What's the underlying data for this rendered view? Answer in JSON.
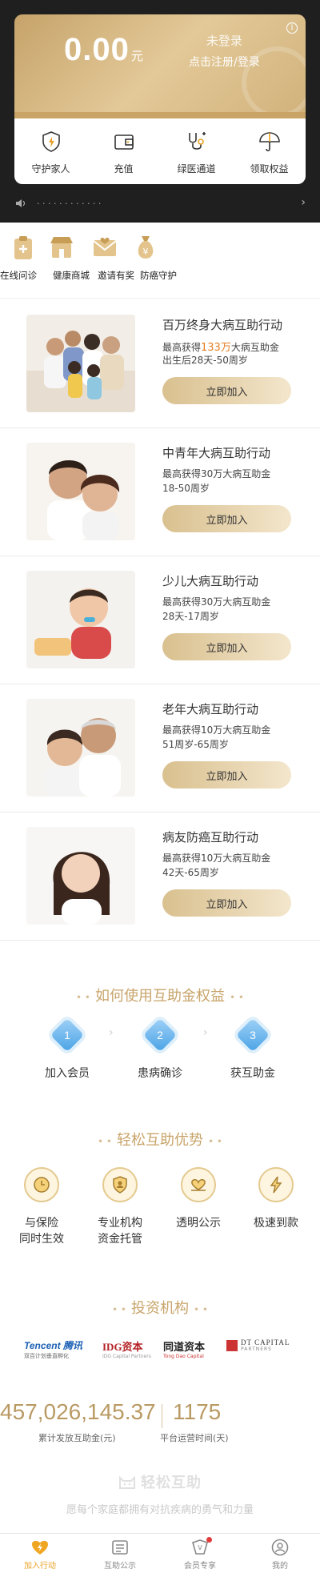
{
  "account": {
    "amount_int": "0",
    "amount_dec": ".00",
    "unit": "元",
    "login_status": "未登录",
    "login_prompt": "点击注册/登录"
  },
  "actions": [
    {
      "label": "守护家人",
      "icon": "shield-lightning-icon"
    },
    {
      "label": "充值",
      "icon": "wallet-icon"
    },
    {
      "label": "绿医通道",
      "icon": "stethoscope-icon"
    },
    {
      "label": "领取权益",
      "icon": "umbrella-icon"
    }
  ],
  "notice": {
    "icon": "speaker-icon",
    "text": "· ·  · · · · · · ·  · · ·"
  },
  "quick_nav": [
    {
      "label": "在线问诊",
      "icon": "clipboard-plus-icon"
    },
    {
      "label": "健康商城",
      "icon": "store-icon"
    },
    {
      "label": "邀请有奖",
      "icon": "envelope-heart-icon"
    },
    {
      "label": "防癌守护",
      "icon": "money-bag-icon"
    }
  ],
  "products": [
    {
      "title": "百万终身大病互助行动",
      "prefix": "最高获得",
      "highlight": "133万",
      "suffix": "大病互助金",
      "age": "出生后28天-50周岁",
      "button": "立即加入"
    },
    {
      "title": "中青年大病互助行动",
      "prefix": "最高获得30万大病互助金",
      "highlight": "",
      "suffix": "",
      "age": "18-50周岁",
      "button": "立即加入"
    },
    {
      "title": "少儿大病互助行动",
      "prefix": "最高获得30万大病互助金",
      "highlight": "",
      "suffix": "",
      "age": "28天-17周岁",
      "button": "立即加入"
    },
    {
      "title": "老年大病互助行动",
      "prefix": "最高获得10万大病互助金",
      "highlight": "",
      "suffix": "",
      "age": "51周岁-65周岁",
      "button": "立即加入"
    },
    {
      "title": "病友防癌互助行动",
      "prefix": "最高获得10万大病互助金",
      "highlight": "",
      "suffix": "",
      "age": "42天-65周岁",
      "button": "立即加入"
    }
  ],
  "how_to": {
    "title": "如何使用互助金权益",
    "steps": [
      {
        "num": "1",
        "label": "加入会员"
      },
      {
        "num": "2",
        "label": "患病确诊"
      },
      {
        "num": "3",
        "label": "获互助金"
      }
    ]
  },
  "advantages": {
    "title": "轻松互助优势",
    "items": [
      {
        "line1": "与保险",
        "line2": "同时生效",
        "icon": "clock-icon"
      },
      {
        "line1": "专业机构",
        "line2": "资金托管",
        "icon": "shield-person-icon"
      },
      {
        "line1": "透明公示",
        "line2": "",
        "icon": "heart-hands-icon"
      },
      {
        "line1": "极速到款",
        "line2": "",
        "icon": "lightning-icon"
      }
    ]
  },
  "investors": {
    "title": "投资机构",
    "logos": [
      {
        "main": "Tencent 腾讯",
        "sub": "双百计划垂直孵化"
      },
      {
        "main": "IDG资本",
        "sub": "IDG Capital Partners"
      },
      {
        "main": "同道资本",
        "sub": "Tong Dao Capital"
      },
      {
        "main": "DT CAPITAL",
        "sub": "PARTNERS"
      }
    ]
  },
  "stats": {
    "total_amount": "457,026,145.37",
    "total_label": "累计发放互助金(元)",
    "days": "1175",
    "days_label": "平台运营时间(天)"
  },
  "brand": {
    "name": "轻松互助",
    "slogan": "愿每个家庭都拥有对抗疾病的勇气和力量"
  },
  "tabs": [
    {
      "label": "加入行动",
      "active": true
    },
    {
      "label": "互助公示",
      "active": false
    },
    {
      "label": "会员专享",
      "active": false
    },
    {
      "label": "我的",
      "active": false
    }
  ],
  "colors": {
    "gold": "#c8a46a",
    "accent": "#e9a227",
    "highlight": "#e67e22",
    "step_blue": "#4aa3e6"
  }
}
